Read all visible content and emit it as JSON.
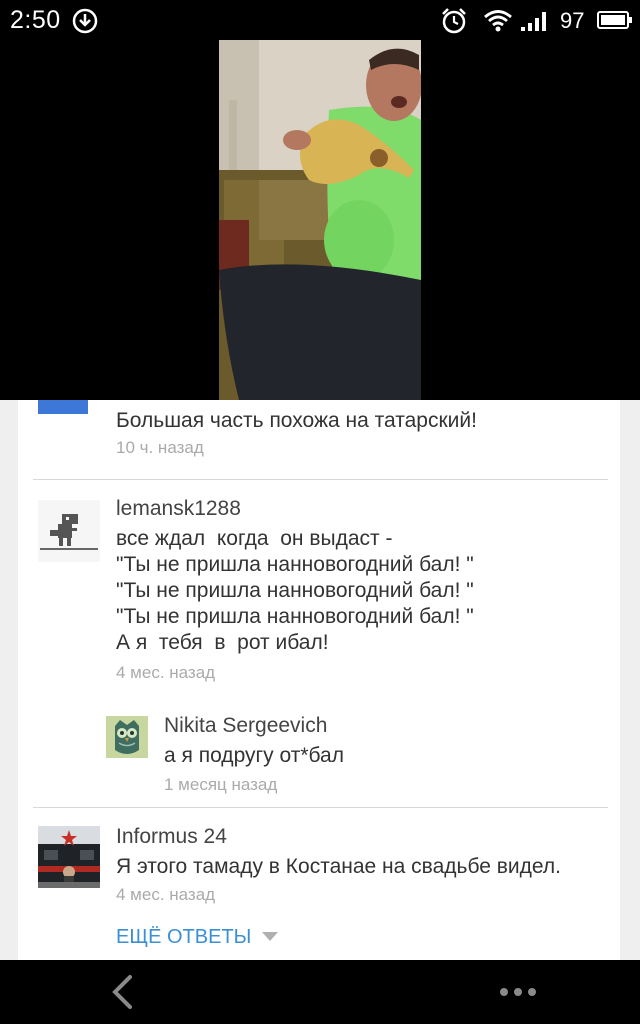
{
  "status_bar": {
    "time": "2:50",
    "battery": "97",
    "icons": [
      "download-icon",
      "alarm-icon",
      "wifi-icon",
      "signal-icon",
      "battery-icon"
    ]
  },
  "video": {
    "description_icon": "video-player"
  },
  "comments": [
    {
      "author": "",
      "text": "Большая часть похожа на татарский!",
      "time": "10 ч. назад",
      "avatar_color": "#3d78d8"
    },
    {
      "author": "lemansk1288",
      "lines": [
        "все ждал  когда  он выдаст -",
        "\"Ты не пришла нанновогодний бал! \"",
        "\"Ты не пришла нанновогодний бал! \"",
        "\"Ты не пришла нанновогодний бал! \"",
        "А я  тебя  в  рот ибал!"
      ],
      "time": "4 мес. назад",
      "avatar": "dino-icon"
    },
    {
      "author": "Nikita Sergeevich",
      "text": "а я подругу от*бал",
      "time": "1 месяц назад",
      "avatar": "owl-icon",
      "is_reply": true
    },
    {
      "author": "Informus 24",
      "text": "Я этого тамаду в Костанае на свадьбе видел.",
      "time": "4 мес. назад",
      "avatar": "locomotive-photo"
    }
  ],
  "more_replies_label": "ЕЩЁ ОТВЕТЫ",
  "colors": {
    "link": "#3b8fd4",
    "background": "#efefef",
    "card": "#ffffff"
  },
  "nav_bar": {
    "icons": [
      "back-icon",
      "more-icon"
    ]
  }
}
